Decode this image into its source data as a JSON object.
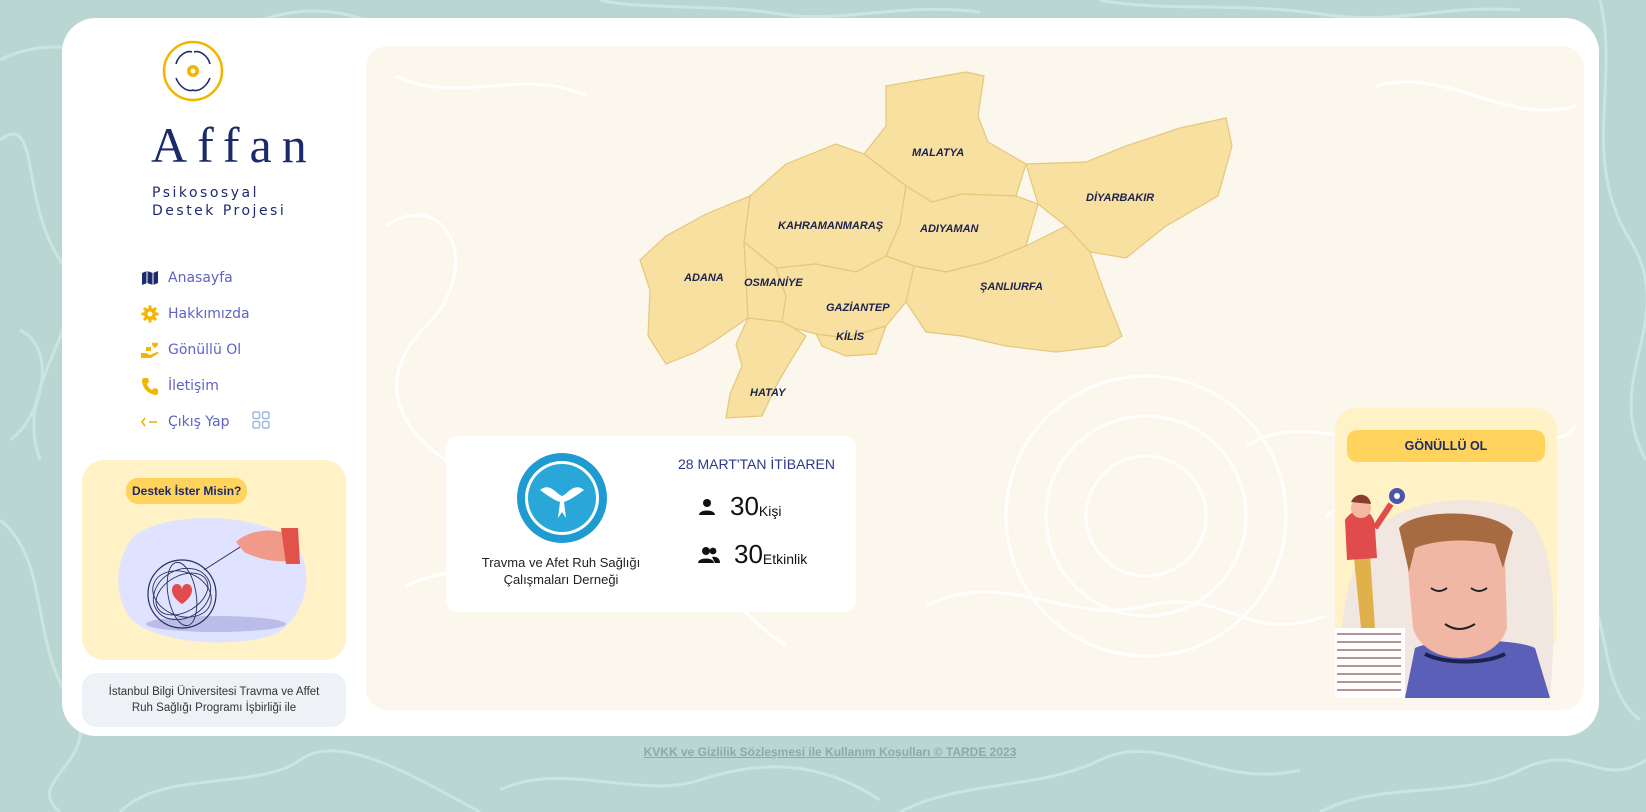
{
  "brand": {
    "name": "Affan",
    "subtitle_line1": "Psikososyal",
    "subtitle_line2": "Destek Projesi"
  },
  "nav": {
    "items": [
      {
        "label": "Anasayfa",
        "icon": "map-icon"
      },
      {
        "label": "Hakkımızda",
        "icon": "gear-icon"
      },
      {
        "label": "Gönüllü Ol",
        "icon": "hand-heart-icon"
      },
      {
        "label": "İletişim",
        "icon": "phone-icon"
      },
      {
        "label": "Çıkış Yap",
        "icon": "logout-icon"
      }
    ]
  },
  "help_card": {
    "button": "Destek İster Misin?"
  },
  "partner": {
    "text_line1": "İstanbul Bilgi Üniversitesi Travma ve Affet",
    "text_line2": "Ruh Sağlığı Programı İşbirliği ile"
  },
  "map": {
    "cities": [
      "MALATYA",
      "DİYARBAKIR",
      "KAHRAMANMARAŞ",
      "ADIYAMAN",
      "ADANA",
      "OSMANİYE",
      "GAZİANTEP",
      "ŞANLIURFA",
      "KİLİS",
      "HATAY"
    ]
  },
  "stats": {
    "org_name_line1": "Travma ve Afet Ruh Sağlığı",
    "org_name_line2": "Çalışmaları Derneği",
    "since": "28 MART'TAN İTİBAREN",
    "people_count": "30",
    "people_unit": "Kişi",
    "events_count": "30",
    "events_unit": "Etkinlik"
  },
  "volunteer": {
    "button": "GÖNÜLLÜ OL"
  },
  "footer": {
    "link": "KVKK ve Gizlilik Sözleşmesi ile Kullanım Koşulları © TARDE 2023"
  },
  "colors": {
    "background": "#b9d6d3",
    "accent_yellow": "#ffd35c",
    "navy": "#1c2a6b",
    "map_fill": "#f8e0a0"
  }
}
